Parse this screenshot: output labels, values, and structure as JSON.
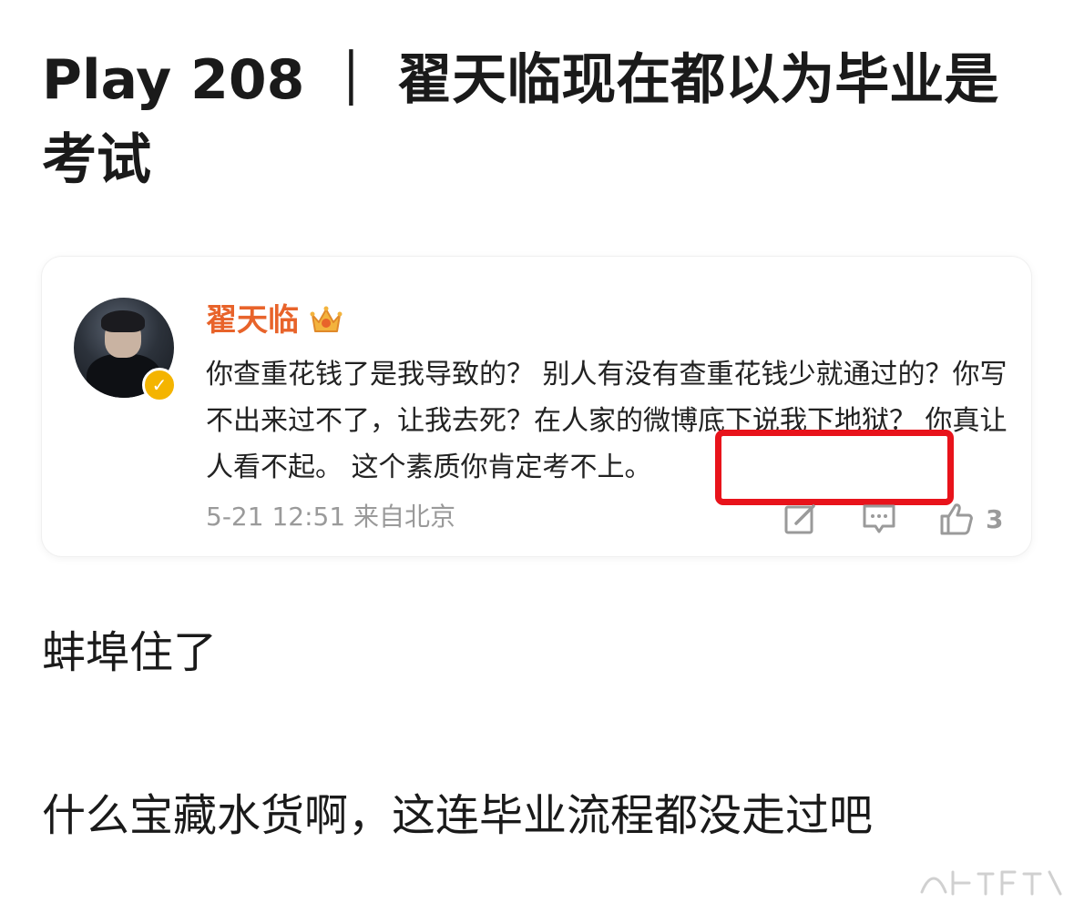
{
  "post": {
    "title": "Play 208 ｜ 翟天临现在都以为毕业是考试",
    "paragraphs": [
      "蚌埠住了",
      "什么宝藏水货啊，这连毕业流程都没走过吧"
    ]
  },
  "weibo_card": {
    "username": "翟天临",
    "username_color": "#e8632a",
    "comment": "你查重花钱了是我导致的？ 别人有没有查重花钱少就通过的？你写不出来过不了，让我去死？在人家的微博底下说我下地狱？  你真让人看不起。  这个素质你肯定考不上。",
    "highlight_color": "#e8131b",
    "timestamp": "5-21 12:51",
    "source": "来自北京",
    "like_count": "3",
    "icons": [
      "crown-icon",
      "verified-icon",
      "edit-icon",
      "comment-icon",
      "like-icon"
    ]
  }
}
